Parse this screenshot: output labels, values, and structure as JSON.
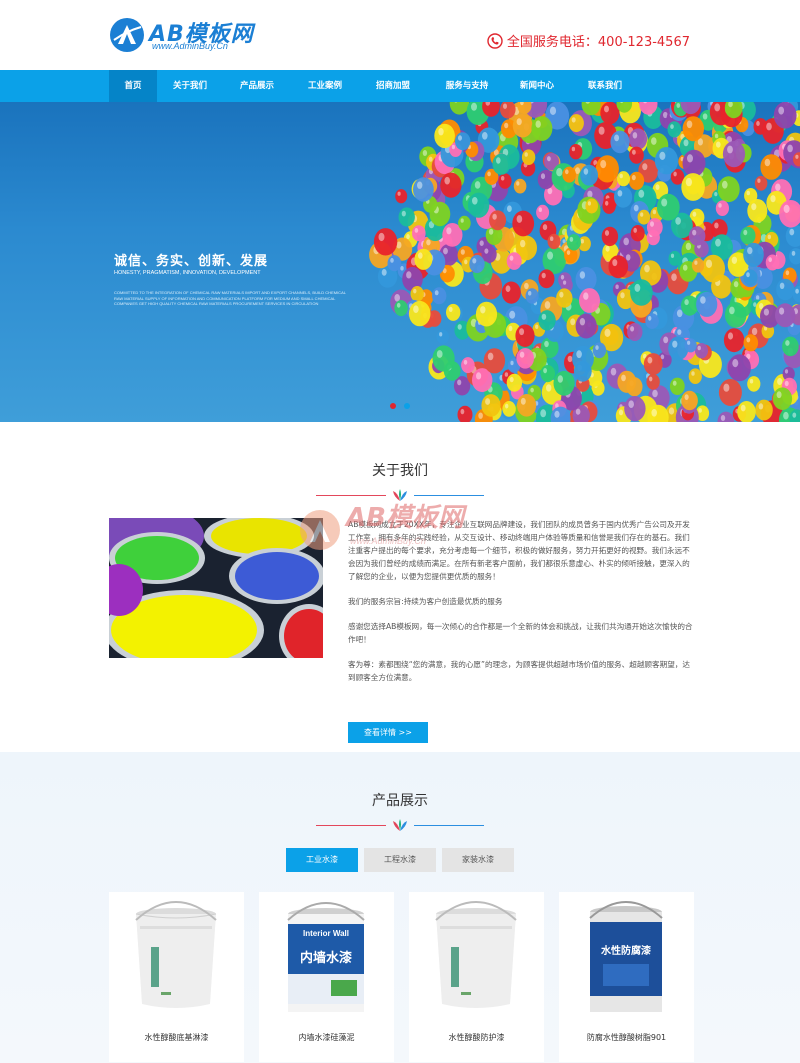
{
  "brand": {
    "logo_text": "AB模板网",
    "logo_sub": "www.AdminBuy.Cn",
    "accent": "#0ba1e8",
    "red": "#e0272f"
  },
  "header": {
    "hotline": "全国服务电话：400-123-4567"
  },
  "nav": {
    "items": [
      {
        "label": "首页"
      },
      {
        "label": "关于我们"
      },
      {
        "label": "产品展示"
      },
      {
        "label": "工业案例"
      },
      {
        "label": "招商加盟"
      },
      {
        "label": "服务与支持"
      },
      {
        "label": "新闻中心"
      },
      {
        "label": "联系我们"
      }
    ]
  },
  "banner": {
    "title": "诚信、务实、创新、发展",
    "subtitle": "HONESTY, PRAGMATISM, INNOVATION, DEVELOPMENT",
    "desc": "COMMITTED TO THE INTEGRATION OF CHEMICAL RAW MATERIALS IMPORT AND EXPORT CHANNELS, BUILD CHEMICAL RAW MATERIAL SUPPLY OF INFORMATION AND COMMUNICATION PLATFORM FOR MEDIUM AND SMALL CHEMICAL COMPANIES GET HIGH QUALITY CHEMICAL RAW MATERIALS PROCUREMENT SERVICES IN CIRCULATION"
  },
  "about": {
    "title": "关于我们",
    "p1": "AB模板网成立于20XX年，专注企业互联网品牌建设，我们团队的成员曾务于国内优秀广告公司及开发工作室，拥有多年的实践经验，从交互设计、移动终端用户体验等质量和信誉是我们存在的基石。我们注重客户提出的每个要求，充分考虑每一个细节，积极的做好服务，努力开拓更好的视野。我们永远不会因为我们曾经的成绩而满足。在所有新老客户面前，我们都很乐意虚心、朴实的倾听接触，更深入的了解您的企业，以便为您提供更优质的服务！",
    "p2": "我们的服务宗旨:持续为客户创造最优质的服务",
    "p3": "感谢您选择AB模板网，每一次倾心的合作都是一个全新的体会和挑战，让我们共沟通开始这次愉快的合作吧！",
    "p4": "客为尊：素都围绕“您的满意，我的心愿”的理念，为顾客提供超越市场价值的服务、超越顾客期望，达到顾客全方位满意。",
    "more": "查看详情 >>"
  },
  "products": {
    "title": "产品展示",
    "tabs": [
      {
        "label": "工业水漆"
      },
      {
        "label": "工程水漆"
      },
      {
        "label": "家装水漆"
      }
    ],
    "items": [
      {
        "name": "水性醇酸底基淋漆"
      },
      {
        "name": "内墙水漆硅藻泥"
      },
      {
        "name": "水性醇酸防护漆"
      },
      {
        "name": "防腐水性醇酸树脂901"
      }
    ]
  }
}
